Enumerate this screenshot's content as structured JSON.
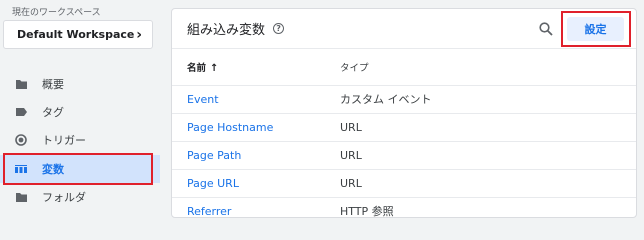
{
  "sidebar": {
    "workspace_label": "現在のワークスペース",
    "workspace_name": "Default Workspace",
    "items": [
      {
        "label": "概要",
        "icon": "folder-icon"
      },
      {
        "label": "タグ",
        "icon": "tag-icon"
      },
      {
        "label": "トリガー",
        "icon": "trigger-icon"
      },
      {
        "label": "変数",
        "icon": "variables-icon",
        "active": true
      },
      {
        "label": "フォルダ",
        "icon": "folder-icon"
      }
    ]
  },
  "main": {
    "title": "組み込み変数",
    "settings_label": "設定",
    "columns": {
      "name": "名前",
      "type": "タイプ"
    },
    "rows": [
      {
        "name": "Event",
        "type": "カスタム イベント"
      },
      {
        "name": "Page Hostname",
        "type": "URL"
      },
      {
        "name": "Page Path",
        "type": "URL"
      },
      {
        "name": "Page URL",
        "type": "URL"
      },
      {
        "name": "Referrer",
        "type": "HTTP 参照"
      }
    ]
  },
  "colors": {
    "accent": "#1a73e8",
    "highlight": "#e0202b",
    "active_bg": "#d2e3fc"
  }
}
